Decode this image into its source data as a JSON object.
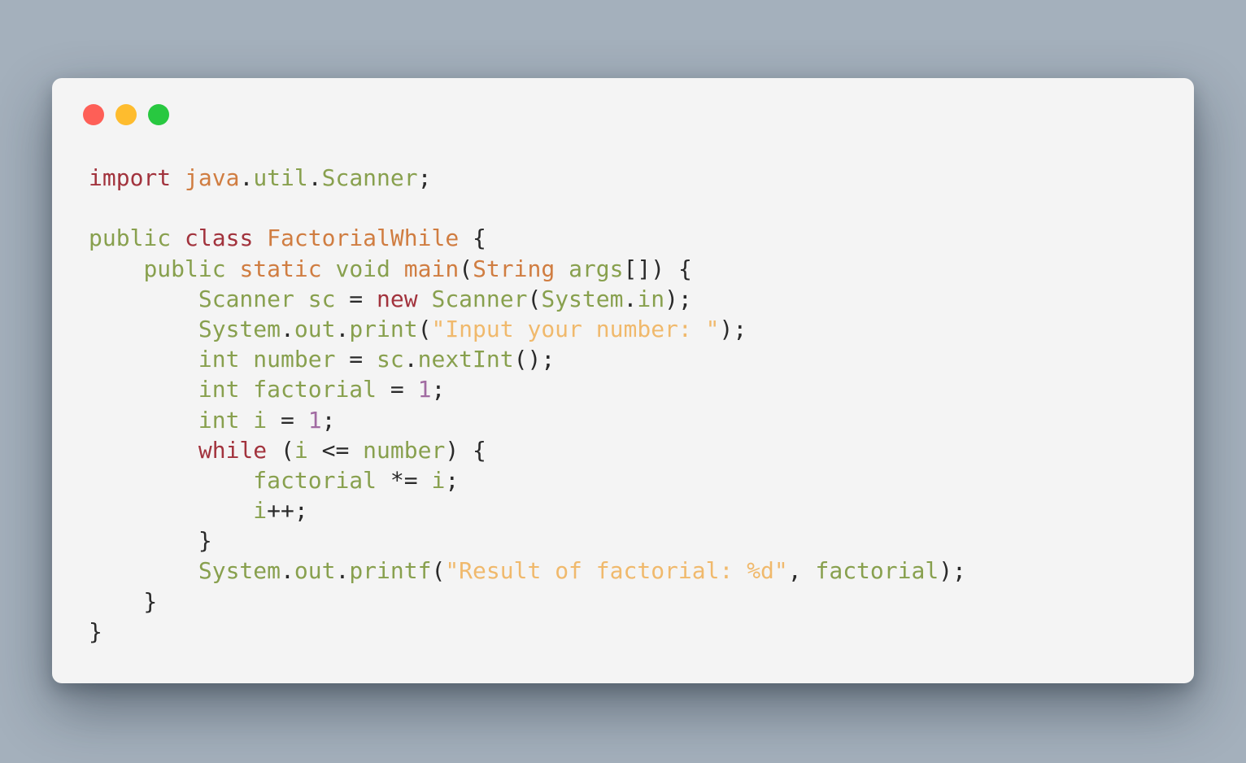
{
  "colors": {
    "background": "#a4b0bc",
    "window": "#f4f4f4",
    "close": "#fe5f57",
    "minimize": "#febc2e",
    "zoom": "#28c840",
    "keyword": "#a2333d",
    "type": "#d07d41",
    "identifier": "#88a04e",
    "string": "#f0b96c",
    "number": "#a16ba2",
    "punctuation": "#2a2a2a"
  },
  "window_controls": [
    {
      "name": "close-button",
      "color": "#fe5f57"
    },
    {
      "name": "minimize-button",
      "color": "#febc2e"
    },
    {
      "name": "zoom-button",
      "color": "#28c840"
    }
  ],
  "code_lines": [
    [
      {
        "t": "import",
        "c": "keyword"
      },
      {
        "t": " "
      },
      {
        "t": "java",
        "c": "type"
      },
      {
        "t": "."
      },
      {
        "t": "util",
        "c": "identifier"
      },
      {
        "t": "."
      },
      {
        "t": "Scanner",
        "c": "identifier"
      },
      {
        "t": ";"
      }
    ],
    [],
    [
      {
        "t": "public",
        "c": "identifier"
      },
      {
        "t": " "
      },
      {
        "t": "class",
        "c": "keyword"
      },
      {
        "t": " "
      },
      {
        "t": "FactorialWhile",
        "c": "type"
      },
      {
        "t": " {"
      }
    ],
    [
      {
        "t": "    "
      },
      {
        "t": "public",
        "c": "identifier"
      },
      {
        "t": " "
      },
      {
        "t": "static",
        "c": "type"
      },
      {
        "t": " "
      },
      {
        "t": "void",
        "c": "identifier"
      },
      {
        "t": " "
      },
      {
        "t": "main",
        "c": "type"
      },
      {
        "t": "("
      },
      {
        "t": "String",
        "c": "type"
      },
      {
        "t": " "
      },
      {
        "t": "args",
        "c": "identifier"
      },
      {
        "t": "[]) {"
      }
    ],
    [
      {
        "t": "        "
      },
      {
        "t": "Scanner",
        "c": "identifier"
      },
      {
        "t": " "
      },
      {
        "t": "sc",
        "c": "identifier"
      },
      {
        "t": " = "
      },
      {
        "t": "new",
        "c": "keyword"
      },
      {
        "t": " "
      },
      {
        "t": "Scanner",
        "c": "identifier"
      },
      {
        "t": "("
      },
      {
        "t": "System",
        "c": "identifier"
      },
      {
        "t": "."
      },
      {
        "t": "in",
        "c": "identifier"
      },
      {
        "t": ");"
      }
    ],
    [
      {
        "t": "        "
      },
      {
        "t": "System",
        "c": "identifier"
      },
      {
        "t": "."
      },
      {
        "t": "out",
        "c": "identifier"
      },
      {
        "t": "."
      },
      {
        "t": "print",
        "c": "identifier"
      },
      {
        "t": "("
      },
      {
        "t": "\"Input your number: \"",
        "c": "string"
      },
      {
        "t": ");"
      }
    ],
    [
      {
        "t": "        "
      },
      {
        "t": "int",
        "c": "identifier"
      },
      {
        "t": " "
      },
      {
        "t": "number",
        "c": "identifier"
      },
      {
        "t": " = "
      },
      {
        "t": "sc",
        "c": "identifier"
      },
      {
        "t": "."
      },
      {
        "t": "nextInt",
        "c": "identifier"
      },
      {
        "t": "();"
      }
    ],
    [
      {
        "t": "        "
      },
      {
        "t": "int",
        "c": "identifier"
      },
      {
        "t": " "
      },
      {
        "t": "factorial",
        "c": "identifier"
      },
      {
        "t": " = "
      },
      {
        "t": "1",
        "c": "number"
      },
      {
        "t": ";"
      }
    ],
    [
      {
        "t": "        "
      },
      {
        "t": "int",
        "c": "identifier"
      },
      {
        "t": " "
      },
      {
        "t": "i",
        "c": "identifier"
      },
      {
        "t": " = "
      },
      {
        "t": "1",
        "c": "number"
      },
      {
        "t": ";"
      }
    ],
    [
      {
        "t": "        "
      },
      {
        "t": "while",
        "c": "keyword"
      },
      {
        "t": " ("
      },
      {
        "t": "i",
        "c": "identifier"
      },
      {
        "t": " <= "
      },
      {
        "t": "number",
        "c": "identifier"
      },
      {
        "t": ") {"
      }
    ],
    [
      {
        "t": "            "
      },
      {
        "t": "factorial",
        "c": "identifier"
      },
      {
        "t": " *= "
      },
      {
        "t": "i",
        "c": "identifier"
      },
      {
        "t": ";"
      }
    ],
    [
      {
        "t": "            "
      },
      {
        "t": "i",
        "c": "identifier"
      },
      {
        "t": "++;"
      }
    ],
    [
      {
        "t": "        }"
      }
    ],
    [
      {
        "t": "        "
      },
      {
        "t": "System",
        "c": "identifier"
      },
      {
        "t": "."
      },
      {
        "t": "out",
        "c": "identifier"
      },
      {
        "t": "."
      },
      {
        "t": "printf",
        "c": "identifier"
      },
      {
        "t": "("
      },
      {
        "t": "\"Result of factorial: %d\"",
        "c": "string"
      },
      {
        "t": ", "
      },
      {
        "t": "factorial",
        "c": "identifier"
      },
      {
        "t": ");"
      }
    ],
    [
      {
        "t": "    }"
      }
    ],
    [
      {
        "t": "}"
      }
    ]
  ]
}
